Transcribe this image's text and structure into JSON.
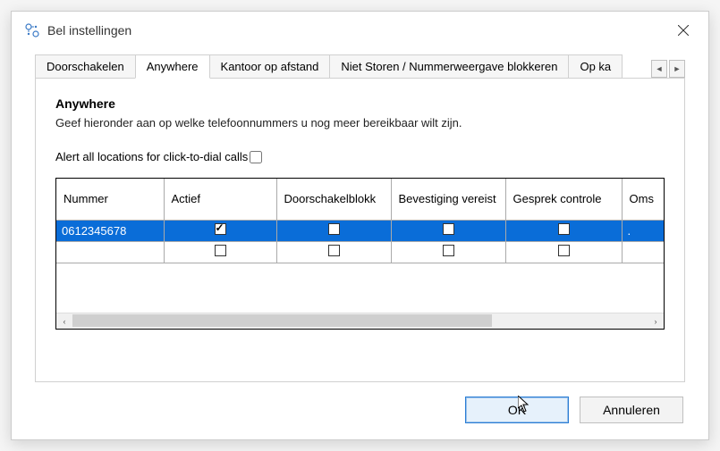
{
  "window": {
    "title": "Bel instellingen"
  },
  "tabs": [
    {
      "label": "Doorschakelen",
      "active": false
    },
    {
      "label": "Anywhere",
      "active": true
    },
    {
      "label": "Kantoor op afstand",
      "active": false
    },
    {
      "label": "Niet Storen / Nummerweergave blokkeren",
      "active": false
    },
    {
      "label": "Op ka",
      "active": false
    }
  ],
  "section": {
    "title": "Anywhere",
    "description": "Geef hieronder aan op welke telefoonnummers u nog meer bereikbaar wilt zijn."
  },
  "alert": {
    "label": "Alert all locations for click-to-dial calls",
    "checked": false
  },
  "grid": {
    "columns": [
      "Nummer",
      "Actief",
      "Doorschakelblokk",
      "Bevestiging vereist",
      "Gesprek controle",
      "Oms"
    ],
    "rows": [
      {
        "nummer": "0612345678",
        "actief": true,
        "doorschakelblok": false,
        "bevestiging": false,
        "gesprek": false,
        "oms": ".",
        "selected": true
      },
      {
        "nummer": "",
        "actief": false,
        "doorschakelblok": false,
        "bevestiging": false,
        "gesprek": false,
        "oms": "",
        "selected": false
      }
    ]
  },
  "buttons": {
    "ok": "OK",
    "cancel": "Annuleren"
  }
}
